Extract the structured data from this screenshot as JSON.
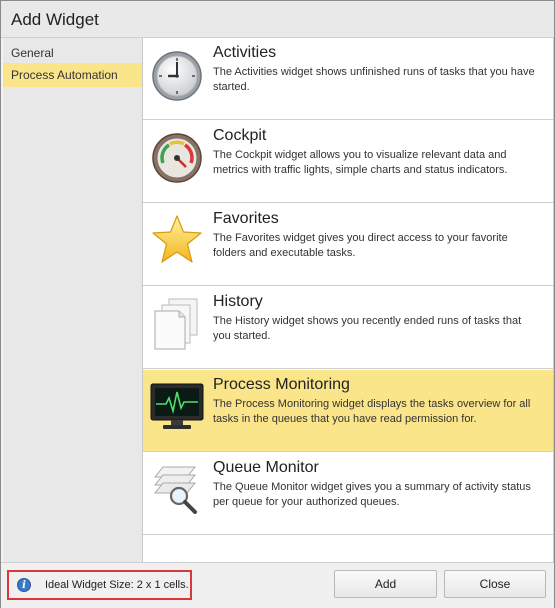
{
  "dialog": {
    "title": "Add Widget"
  },
  "sidebar": {
    "items": [
      {
        "label": "General",
        "selected": false
      },
      {
        "label": "Process Automation",
        "selected": true
      }
    ]
  },
  "widgets": [
    {
      "name": "Activities",
      "icon": "clock-icon",
      "description": "The Activities widget shows unfinished runs of tasks that you have started.",
      "selected": false
    },
    {
      "name": "Cockpit",
      "icon": "gauge-icon",
      "description": "The Cockpit widget allows you to visualize relevant data and metrics with traffic lights, simple charts and status indicators.",
      "selected": false
    },
    {
      "name": "Favorites",
      "icon": "star-icon",
      "description": "The Favorites widget gives you direct access to your favorite folders and executable tasks.",
      "selected": false
    },
    {
      "name": "History",
      "icon": "documents-icon",
      "description": "The History widget shows you recently ended runs of tasks that you started.",
      "selected": false
    },
    {
      "name": "Process Monitoring",
      "icon": "monitor-icon",
      "description": "The Process Monitoring widget displays the tasks overview for all tasks in the queues that you have read permission for.",
      "selected": true
    },
    {
      "name": "Queue Monitor",
      "icon": "queue-magnifier-icon",
      "description": "The Queue Monitor widget gives you a summary of activity status per queue for your authorized queues.",
      "selected": false
    }
  ],
  "footer": {
    "info_glyph": "i",
    "hint": "Ideal Widget Size: 2 x 1 cells.",
    "add_label": "Add",
    "close_label": "Close"
  },
  "colors": {
    "selection": "#fbe58a",
    "hint_border": "#d9383a",
    "info_blue": "#3b78c8"
  }
}
